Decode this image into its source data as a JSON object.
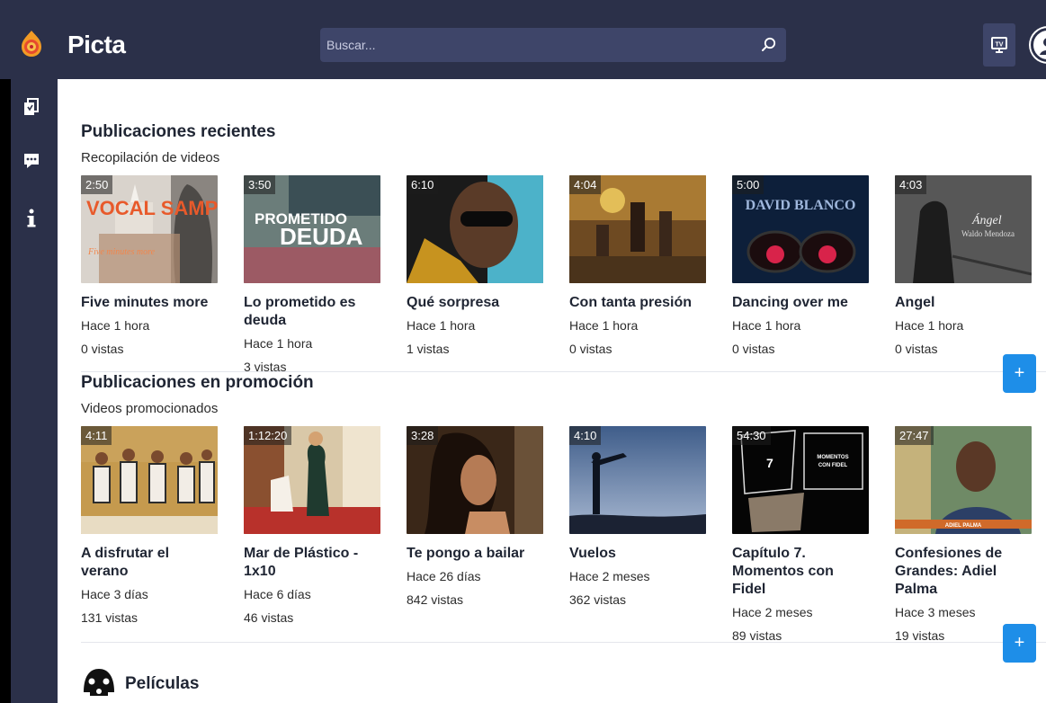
{
  "brand": "Picta",
  "search": {
    "placeholder": "Buscar..."
  },
  "sections": [
    {
      "title": "Publicaciones recientes",
      "subtitle": "Recopilación de videos",
      "items": [
        {
          "duration": "2:50",
          "title": "Five minutes more",
          "time": "Hace 1 hora",
          "views": "0 vistas",
          "thumb_text": "VOCAL SAMPLING"
        },
        {
          "duration": "3:50",
          "title": "Lo prometido es deuda",
          "time": "Hace 1 hora",
          "views": "3 vistas",
          "thumb_text": "LO PROMETIDO ES DEUDA"
        },
        {
          "duration": "6:10",
          "title": "Qué sorpresa",
          "time": "Hace 1 hora",
          "views": "1 vistas"
        },
        {
          "duration": "4:04",
          "title": "Con tanta presión",
          "time": "Hace 1 hora",
          "views": "0 vistas"
        },
        {
          "duration": "5:00",
          "title": "Dancing over me",
          "time": "Hace 1 hora",
          "views": "0 vistas",
          "thumb_text": "DAVID BLANCO"
        },
        {
          "duration": "4:03",
          "title": "Angel",
          "time": "Hace 1 hora",
          "views": "0 vistas",
          "thumb_text": "Ángel"
        }
      ],
      "more_label": "+"
    },
    {
      "title": "Publicaciones en promoción",
      "subtitle": "Videos promocionados",
      "items": [
        {
          "duration": "4:11",
          "title": "A disfrutar el verano",
          "time": "Hace 3 días",
          "views": "131 vistas"
        },
        {
          "duration": "1:12:20",
          "title": "Mar de Plástico - 1x10",
          "time": "Hace 6 días",
          "views": "46 vistas"
        },
        {
          "duration": "3:28",
          "title": "Te pongo a bailar",
          "time": "Hace 26 días",
          "views": "842 vistas"
        },
        {
          "duration": "4:10",
          "title": "Vuelos",
          "time": "Hace 2 meses",
          "views": "362 vistas"
        },
        {
          "duration": "54:30",
          "title": "Capítulo 7. Momentos con Fidel",
          "time": "Hace 2 meses",
          "views": "89 vistas",
          "thumb_text": "MOMENTOS CON FIDEL"
        },
        {
          "duration": "27:47",
          "title": "Confesiones de Grandes: Adiel Palma",
          "time": "Hace 3 meses",
          "views": "19 vistas",
          "thumb_text": "ADIEL PALMA"
        }
      ],
      "more_label": "+"
    }
  ],
  "movies_label": "Películas",
  "icons": {
    "logo": "picta-logo-icon",
    "search": "search-icon",
    "tv": "tv-icon",
    "user": "user-avatar",
    "collections": "collections-icon",
    "chat": "chat-icon",
    "info": "info-icon",
    "movies": "movies-icon"
  },
  "colors": {
    "topbar": "#2b3049",
    "sidebar": "#2b3049",
    "search_bg": "#3e4569",
    "accent": "#1e8ee8",
    "text": "#1f2533"
  }
}
